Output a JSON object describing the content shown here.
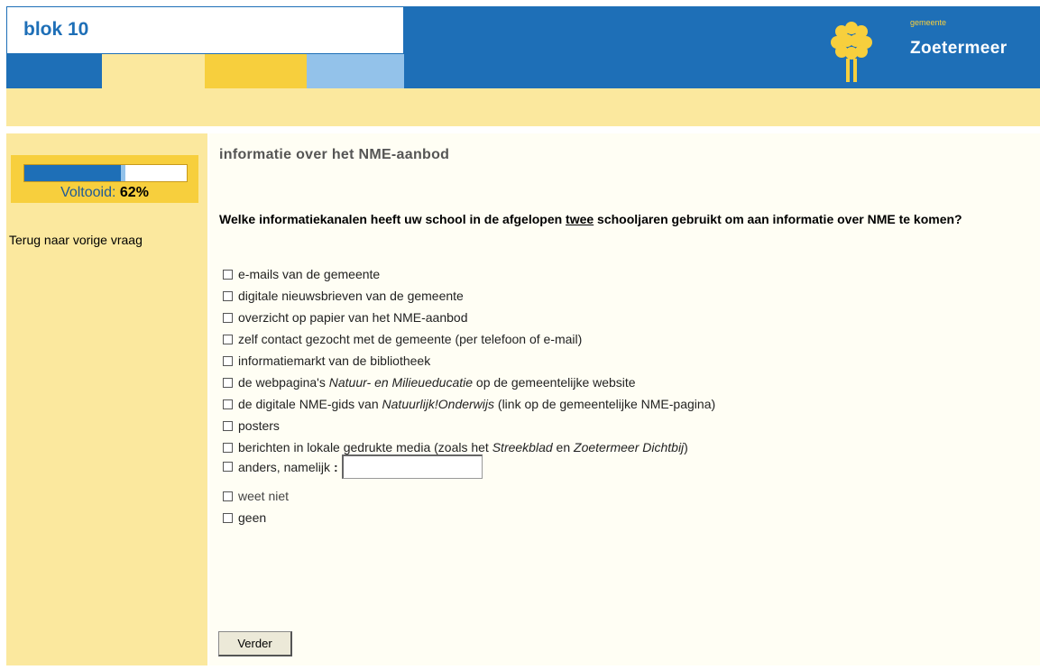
{
  "header": {
    "blok_title": "blok 10",
    "brand_small": "gemeente",
    "brand_main": "Zoetermeer",
    "colors": {
      "blue": "#1e6fb7",
      "yellow": "#f7cf3d",
      "light_yellow": "#fbe89e",
      "light_blue": "#93c2ea"
    }
  },
  "sidebar": {
    "progress_label": "Voltooid:",
    "progress_value": "62%",
    "progress_fraction": 0.62,
    "back_link": "Terug naar vorige vraag"
  },
  "main": {
    "section_title": "informatie over het NME-aanbod",
    "question_pre": "Welke informatiekanalen heeft uw school in de afgelopen ",
    "question_underlined": "twee",
    "question_post": " schooljaren gebruikt om aan informatie over NME te komen?",
    "options": {
      "o1": "e-mails van de gemeente",
      "o2": "digitale nieuwsbrieven van de gemeente",
      "o3": "overzicht op papier van het NME-aanbod",
      "o4": "zelf contact gezocht met de gemeente (per telefoon of e-mail)",
      "o5": "informatiemarkt van de bibliotheek",
      "o6_a": "de webpagina's ",
      "o6_b": "Natuur- en Milieueducatie",
      "o6_c": " op de gemeentelijke website",
      "o7_a": "de digitale NME-gids van ",
      "o7_b": "Natuurlijk!Onderwijs",
      "o7_c": " (link op de gemeentelijke NME-pagina)",
      "o8": "posters",
      "o9_a": "berichten in lokale gedrukte media (zoals het ",
      "o9_b": "Streekblad",
      "o9_c": " en ",
      "o9_d": "Zoetermeer Dichtbij",
      "o9_e": ")",
      "o10": "anders, namelijk",
      "o10_sep": ":",
      "o10_value": "",
      "o11": "weet niet",
      "o12": "geen"
    },
    "next_button": "Verder"
  }
}
